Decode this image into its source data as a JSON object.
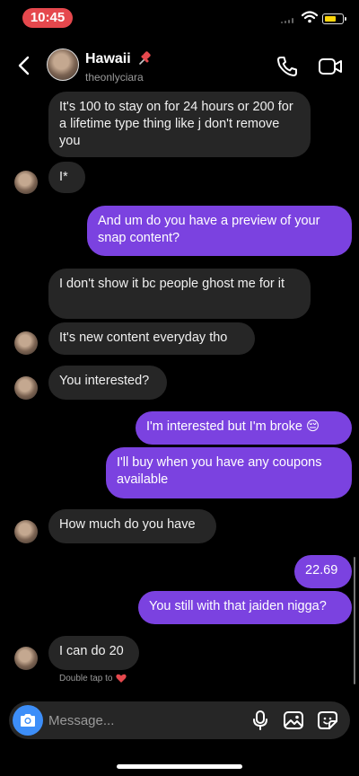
{
  "status": {
    "time": "10:45"
  },
  "header": {
    "title": "Hawaii",
    "subtitle": "theonlyciara"
  },
  "messages": [
    {
      "from": "them",
      "text": "It's 100 to stay on for 24 hours or 200 for a lifetime type thing like j don't remove you"
    },
    {
      "from": "them",
      "text": "I*"
    },
    {
      "from": "me",
      "text": "And um do you have a preview of your snap content?"
    },
    {
      "from": "them",
      "text": "I don't show it bc people ghost me for it"
    },
    {
      "from": "them",
      "text": "It's new content everyday tho"
    },
    {
      "from": "them",
      "text": "You interested?"
    },
    {
      "from": "me",
      "text": "I'm interested but I'm broke 😔"
    },
    {
      "from": "me",
      "text": "I'll buy when you have any coupons available"
    },
    {
      "from": "them",
      "text": "How much do you have"
    },
    {
      "from": "me",
      "text": "22.69"
    },
    {
      "from": "me",
      "text": "You still with that jaiden nigga?"
    },
    {
      "from": "them",
      "text": "I can do 20"
    }
  ],
  "double_tap_hint": "Double tap to",
  "composer": {
    "placeholder": "Message..."
  },
  "colors": {
    "sent_bubble": "#7b42e0",
    "received_bubble": "#262626",
    "camera_button": "#3d8ef8",
    "time_pill": "#e5484d"
  }
}
